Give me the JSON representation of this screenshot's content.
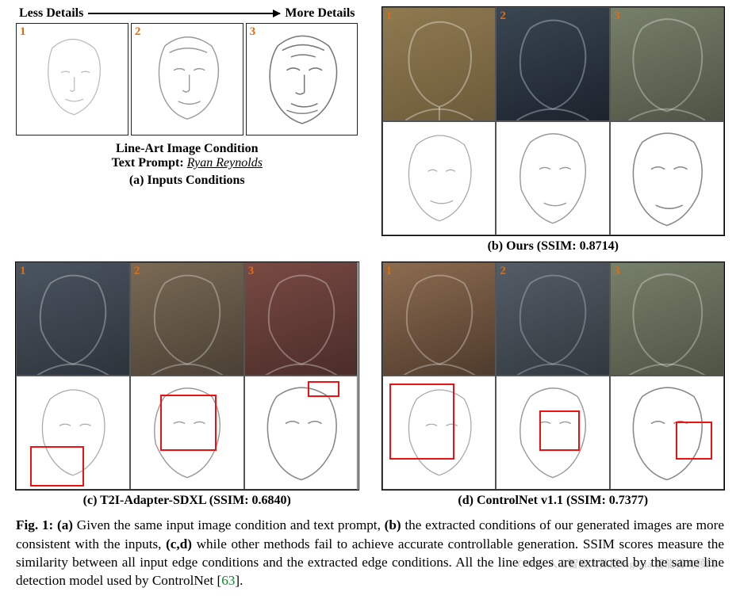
{
  "arrow": {
    "left": "Less Details",
    "right": "More Details"
  },
  "inputs": {
    "condition_title": "Line-Art Image Condition",
    "prompt_label": "Text Prompt:",
    "prompt_value": "Ryan Reynolds",
    "caption": "(a) Inputs Conditions",
    "tiles": [
      {
        "num": "1"
      },
      {
        "num": "2"
      },
      {
        "num": "3"
      }
    ]
  },
  "panels": {
    "b": {
      "caption": "(b) Ours (SSIM: 0.8714)",
      "ssim": 0.8714,
      "top_nums": [
        "1",
        "2",
        "3"
      ]
    },
    "c": {
      "caption": "(c) T2I-Adapter-SDXL (SSIM: 0.6840)",
      "ssim": 0.684,
      "top_nums": [
        "1",
        "2",
        "3"
      ]
    },
    "d": {
      "caption": "(d) ControlNet v1.1 (SSIM: 0.7377)",
      "ssim": 0.7377,
      "top_nums": [
        "1",
        "2",
        "3"
      ]
    }
  },
  "caption": {
    "figlabel": "Fig. 1:",
    "a": "(a)",
    "b": "(b)",
    "cd": "(c,d)",
    "text_a": " Given the same input image condition and text prompt, ",
    "text_b": " the extracted conditions of our generated images are more consistent with the inputs, ",
    "text_cd": " while other methods fail to achieve accurate controllable generation. SSIM scores measure the similarity between all input edge conditions and the extracted edge conditions. All the line edges are extracted by the same line detection model used by ControlNet ",
    "cite": "63",
    "period": "."
  },
  "watermark": "CSDN  人工智能大数据Bigdata  智能咨询顾问"
}
